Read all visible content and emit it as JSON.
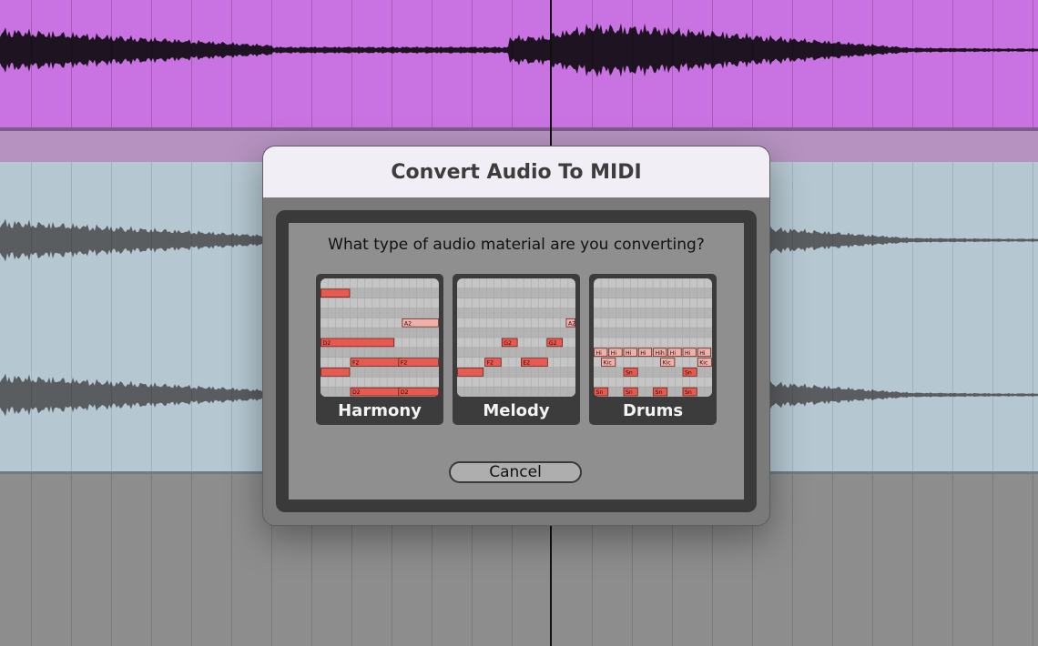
{
  "dialog": {
    "title": "Convert Audio To MIDI",
    "question": "What type of audio material are you converting?",
    "cancel_label": "Cancel",
    "options": [
      {
        "label": "Harmony",
        "notes": [
          {
            "row": 1,
            "start": 0,
            "len": 4,
            "text": ""
          },
          {
            "row": 4,
            "start": 11,
            "len": 5,
            "text": "A2"
          },
          {
            "row": 6,
            "start": 0,
            "len": 10,
            "text": "D2"
          },
          {
            "row": 8,
            "start": 4,
            "len": 7,
            "text": "F2"
          },
          {
            "row": 8,
            "start": 10.5,
            "len": 5.5,
            "text": "F2"
          },
          {
            "row": 9,
            "start": 0,
            "len": 4,
            "text": ""
          },
          {
            "row": 11,
            "start": 4,
            "len": 7,
            "text": "D2"
          },
          {
            "row": 11,
            "start": 10.5,
            "len": 5.5,
            "text": "D2"
          }
        ]
      },
      {
        "label": "Melody",
        "notes": [
          {
            "row": 4,
            "start": 14.7,
            "len": 1.3,
            "text": "A2"
          },
          {
            "row": 6,
            "start": 6,
            "len": 2.2,
            "text": "G2"
          },
          {
            "row": 6,
            "start": 12.1,
            "len": 2.2,
            "text": "G2"
          },
          {
            "row": 8,
            "start": 3.7,
            "len": 2.3,
            "text": "F2"
          },
          {
            "row": 8,
            "start": 8.6,
            "len": 3.7,
            "text": "E2"
          },
          {
            "row": 9,
            "start": 0,
            "len": 3.6,
            "text": ""
          }
        ]
      },
      {
        "label": "Drums",
        "notes": [
          {
            "row": 7,
            "start": 0,
            "len": 1.9,
            "text": "Hi"
          },
          {
            "row": 7,
            "start": 2,
            "len": 1.9,
            "text": "Hi"
          },
          {
            "row": 7,
            "start": 4,
            "len": 1.9,
            "text": "Hi"
          },
          {
            "row": 7,
            "start": 6,
            "len": 1.9,
            "text": "Hi"
          },
          {
            "row": 7,
            "start": 8,
            "len": 1.9,
            "text": "Hih"
          },
          {
            "row": 7,
            "start": 10,
            "len": 1.9,
            "text": "Hi"
          },
          {
            "row": 7,
            "start": 12,
            "len": 1.9,
            "text": "Hi"
          },
          {
            "row": 7,
            "start": 14,
            "len": 1.9,
            "text": "Hi"
          },
          {
            "row": 8,
            "start": 1,
            "len": 2,
            "text": "Kic"
          },
          {
            "row": 8,
            "start": 9,
            "len": 2,
            "text": "Kic"
          },
          {
            "row": 8,
            "start": 14,
            "len": 2,
            "text": "Kic"
          },
          {
            "row": 9,
            "start": 4,
            "len": 2,
            "text": "Sn"
          },
          {
            "row": 9,
            "start": 12,
            "len": 2,
            "text": "Sn"
          },
          {
            "row": 11,
            "start": 0,
            "len": 2,
            "text": "Sn"
          },
          {
            "row": 11,
            "start": 4,
            "len": 2,
            "text": "Sn"
          },
          {
            "row": 11,
            "start": 8,
            "len": 2,
            "text": "Sn"
          },
          {
            "row": 11,
            "start": 12,
            "len": 2,
            "text": "Sn"
          }
        ]
      }
    ]
  },
  "colors": {
    "track_purple": "#c873e1",
    "track_blue": "#b5c7d1",
    "track_gray": "#8d8d8d",
    "note_red": "#e85a4f",
    "note_light": "#f0b1ab"
  }
}
